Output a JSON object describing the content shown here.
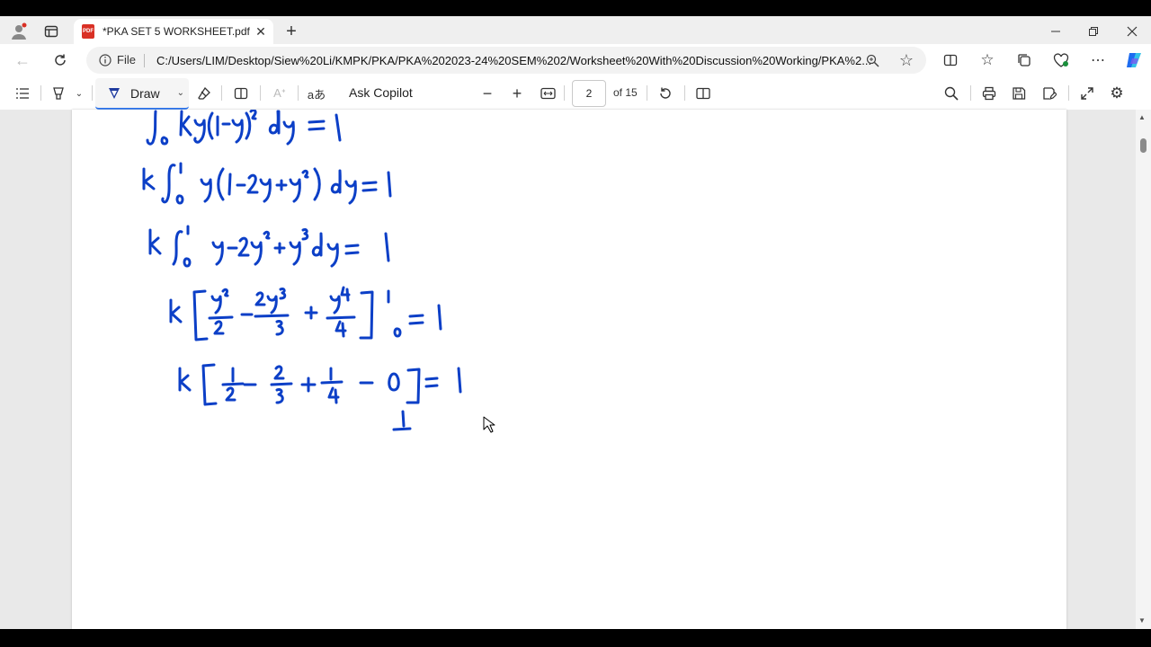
{
  "browser": {
    "tab_title": "*PKA SET 5 WORKSHEET.pdf",
    "file_label": "File",
    "url": "C:/Users/LIM/Desktop/Siew%20Li/KMPK/PKA/PKA%202023-24%20SEM%202/Worksheet%20With%20Discussion%20Working/PKA%2..."
  },
  "pdf_toolbar": {
    "draw_label": "Draw",
    "copilot_label": "Ask Copilot",
    "page_current": "2",
    "page_total": "of 15"
  },
  "icons": [
    "profile-icon",
    "tab-actions-icon",
    "pdf-icon",
    "close-tab-icon",
    "new-tab-icon",
    "minimize-icon",
    "restore-icon",
    "close-window-icon",
    "back-icon",
    "refresh-icon",
    "info-icon",
    "zoom-icon",
    "favorite-icon",
    "split-screen-icon",
    "favorites-icon",
    "collections-icon",
    "browser-essentials-icon",
    "more-icon",
    "copilot-icon",
    "contents-icon",
    "highlight-icon",
    "draw-pen-icon",
    "eraser-icon",
    "page-view-icon",
    "read-aloud-icon",
    "translate-icon",
    "zoom-out-icon",
    "zoom-in-icon",
    "fit-width-icon",
    "rotate-icon",
    "two-page-icon",
    "search-icon",
    "print-icon",
    "save-icon",
    "save-as-icon",
    "full-screen-icon",
    "settings-icon"
  ],
  "colors": {
    "ink": "#0c3fc7",
    "copilot": "#1e6cf0",
    "pdf_badge": "#d93025"
  }
}
